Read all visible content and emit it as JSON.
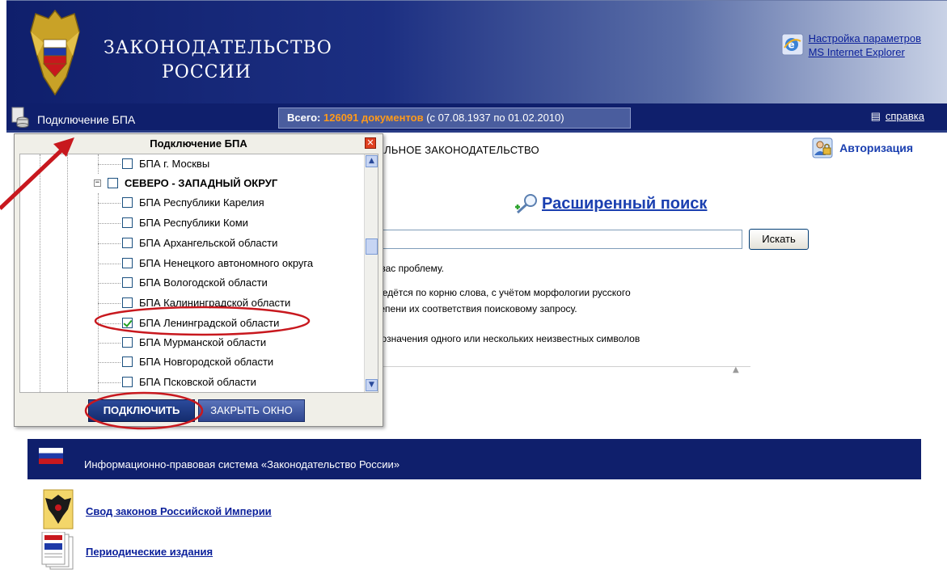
{
  "header": {
    "title_line1": "ЗАКОНОДАТЕЛЬСТВО",
    "title_line2": "РОССИИ",
    "ie_link_1": "Настройка параметров",
    "ie_link_2": "MS Internet Explorer"
  },
  "topbar": {
    "bpa_link": "Подключение БПА",
    "total_label": "Всего:",
    "total_count": "126091 документов",
    "total_range": "(с 07.08.1937 по 01.02.2010)",
    "help_label": "справка"
  },
  "breadcrumb": "РАЛЬНОЕ ЗАКОНОДАТЕЛЬСТВО",
  "auth": {
    "label": "Авторизация"
  },
  "search": {
    "advanced_label": "Расширенный поиск",
    "input_value": "",
    "button_label": "Искать",
    "help_lines": [
      "ю вас проблему.",
      "к ведётся по корню слова, с учётом морфологии русского",
      "степени их соответствия поисковому запросу.",
      "обозначения одного или нескольких неизвестных символов"
    ]
  },
  "footer": {
    "bar_text": "Информационно-правовая система «Законодательство России»",
    "link_1": "Свод законов Российской Империи",
    "link_2": "Периодические издания"
  },
  "popup": {
    "title": "Подключение БПА",
    "close_glyph": "✕",
    "items": [
      {
        "label": "БПА г. Москвы",
        "checked": false
      },
      {
        "label": "СЕВЕРО - ЗАПАДНЫЙ ОКРУГ",
        "checked": false,
        "region": true
      },
      {
        "label": "БПА Республики Карелия",
        "checked": false
      },
      {
        "label": "БПА Республики Коми",
        "checked": false
      },
      {
        "label": "БПА Архангельской области",
        "checked": false
      },
      {
        "label": "БПА Ненецкого автономного округа",
        "checked": false
      },
      {
        "label": "БПА Вологодской области",
        "checked": false
      },
      {
        "label": "БПА Калининградской области",
        "checked": false
      },
      {
        "label": "БПА Ленинградской области",
        "checked": true
      },
      {
        "label": "БПА Мурманской области",
        "checked": false
      },
      {
        "label": "БПА Новгородской области",
        "checked": false
      },
      {
        "label": "БПА Псковской области",
        "checked": false
      }
    ],
    "connect_label": "ПОДКЛЮЧИТЬ",
    "close_label": "ЗАКРЫТЬ ОКНО"
  },
  "colors": {
    "header_dark": "#0f1f6c",
    "link_blue": "#1a3fb0",
    "annotation_red": "#c8181e",
    "count_orange": "#ff9a1a"
  },
  "icons": [
    "emblem-icon",
    "ie-icon",
    "database-icon",
    "help-icon",
    "auth-lock-icon",
    "advanced-search-icon",
    "russia-flag-icon",
    "imperial-eagle-icon",
    "periodicals-icon"
  ]
}
